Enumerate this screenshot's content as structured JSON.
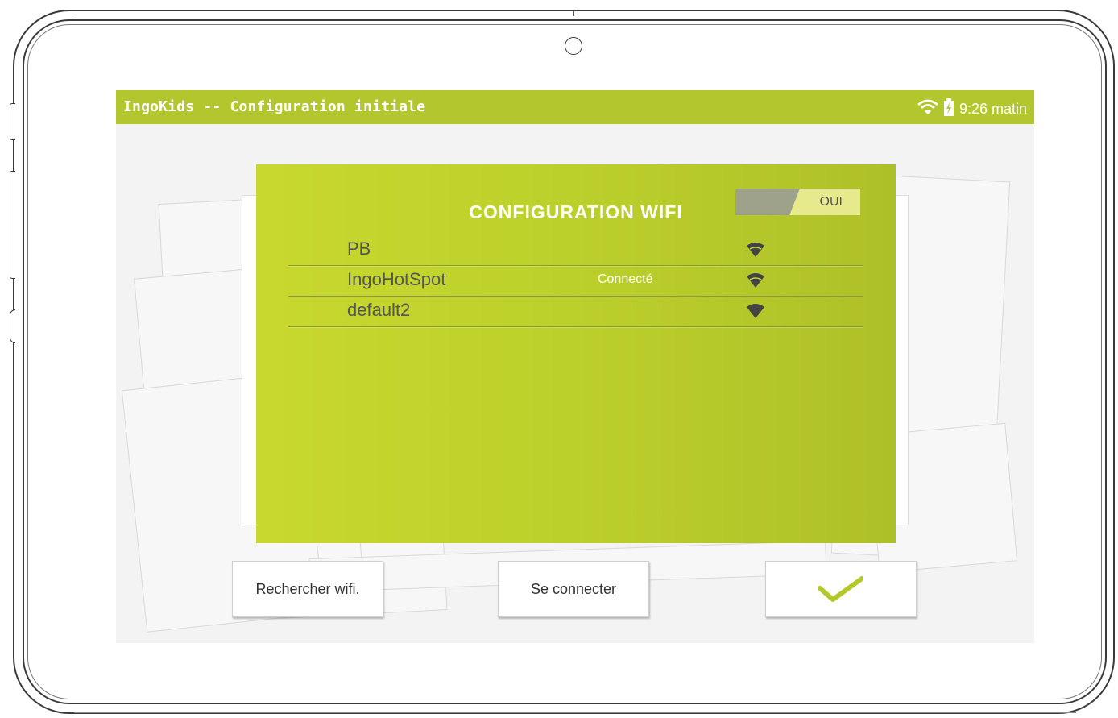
{
  "status_bar": {
    "title": "IngoKids -- Configuration initiale",
    "time": "9:26 matin",
    "icons": [
      "wifi-icon",
      "battery-charging-icon"
    ],
    "color": "#b4c62e"
  },
  "wifi_panel": {
    "heading": "CONFIGURATION WIFI",
    "toggle_label": "OUI",
    "networks": [
      {
        "ssid": "PB",
        "status": ""
      },
      {
        "ssid": "IngoHotSpot",
        "status": "Connecté"
      },
      {
        "ssid": "default2",
        "status": ""
      }
    ],
    "accent": "#c3d52d"
  },
  "buttons": {
    "scan": "Rechercher wifi.",
    "connect": "Se connecter",
    "confirm_icon": "check-icon",
    "check_color": "#b5c82b"
  }
}
